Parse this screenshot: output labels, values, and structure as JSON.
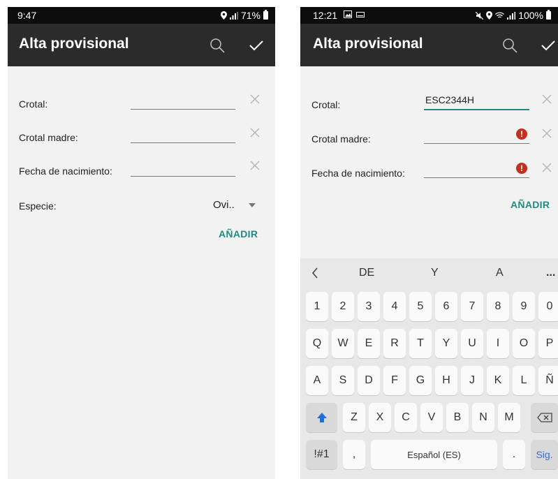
{
  "colors": {
    "accent": "#1e8c82",
    "error": "#c4301e",
    "appbar": "#2b2b2b",
    "statusbar": "#0d0d0d"
  },
  "left": {
    "status": {
      "time": "9:47",
      "battery": "71%"
    },
    "appbar": {
      "title": "Alta provisional",
      "icons": [
        "search-icon",
        "check-icon"
      ]
    },
    "form": {
      "crotal_label": "Crotal:",
      "madre_label": "Crotal madre:",
      "fecha_label": "Fecha de nacimiento:",
      "especie_label": "Especie:",
      "especie_value": "Ovi..",
      "add_label": "AÑADIR"
    }
  },
  "right": {
    "status": {
      "time": "12:21",
      "battery": "100%"
    },
    "appbar": {
      "title": "Alta provisional",
      "icons": [
        "search-icon",
        "check-icon"
      ]
    },
    "form": {
      "crotal_label": "Crotal:",
      "crotal_value": "ESC2344H",
      "madre_label": "Crotal madre:",
      "fecha_label": "Fecha de nacimiento:",
      "error_glyph": "!",
      "add_label": "AÑADIR"
    },
    "keyboard": {
      "suggestions": [
        "DE",
        "Y",
        "A",
        "..."
      ],
      "row_numbers": [
        "1",
        "2",
        "3",
        "4",
        "5",
        "6",
        "7",
        "8",
        "9",
        "0"
      ],
      "row_q": [
        "Q",
        "W",
        "E",
        "R",
        "T",
        "Y",
        "U",
        "I",
        "O",
        "P"
      ],
      "row_a": [
        "A",
        "S",
        "D",
        "F",
        "G",
        "H",
        "J",
        "K",
        "L",
        "Ñ"
      ],
      "row_z": [
        "Z",
        "X",
        "C",
        "V",
        "B",
        "N",
        "M"
      ],
      "symbols_key": "!#1",
      "comma_key": ",",
      "space_key": "Español (ES)",
      "period_key": ".",
      "next_key": "Sig."
    }
  }
}
